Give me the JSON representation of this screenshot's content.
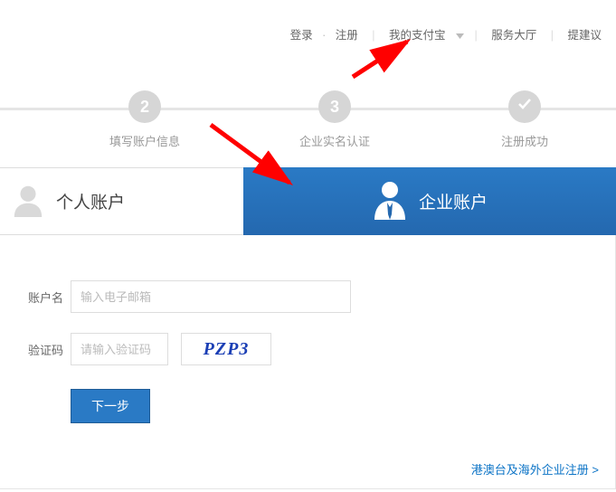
{
  "topnav": {
    "login": "登录",
    "register": "注册",
    "myalipay": "我的支付宝",
    "servicehall": "服务大厅",
    "suggest": "提建议"
  },
  "steps": {
    "s2": {
      "num": "2",
      "label": "填写账户信息"
    },
    "s3": {
      "num": "3",
      "label": "企业实名认证"
    },
    "s4": {
      "label": "注册成功"
    }
  },
  "tabs": {
    "personal": "个人账户",
    "corporate": "企业账户"
  },
  "form": {
    "account_label": "账户名",
    "account_placeholder": "输入电子邮箱",
    "captcha_label": "验证码",
    "captcha_placeholder": "请输入验证码",
    "captcha_text": "PZP3",
    "next": "下一步"
  },
  "links": {
    "overseas": "港澳台及海外企业注册 >"
  }
}
